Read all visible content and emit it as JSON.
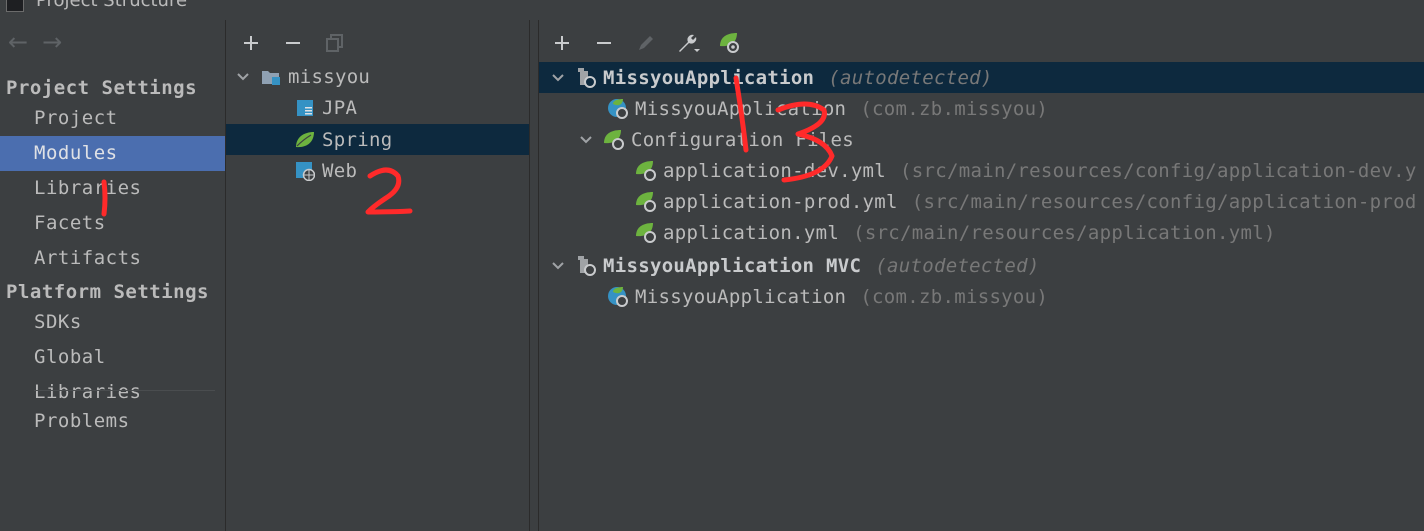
{
  "window": {
    "title": "Project Structure"
  },
  "left": {
    "project_settings_header": "Project Settings",
    "project_items": [
      "Project",
      "Modules",
      "Libraries",
      "Facets",
      "Artifacts"
    ],
    "selected_item": "Modules",
    "platform_settings_header": "Platform Settings",
    "platform_items": [
      "SDKs",
      "Global Libraries"
    ],
    "problems": "Problems"
  },
  "middle": {
    "module": "missyou",
    "facets": [
      "JPA",
      "Spring",
      "Web"
    ],
    "selected_facet": "Spring"
  },
  "right": {
    "contexts": [
      {
        "name": "MissyouApplication",
        "suffix": "(autodetected)",
        "app_class": "MissyouApplication",
        "app_package": "(com.zb.missyou)",
        "config_group": "Configuration Files",
        "files": [
          {
            "name": "application-dev.yml",
            "path": "(src/main/resources/config/application-dev.y"
          },
          {
            "name": "application-prod.yml",
            "path": "(src/main/resources/config/application-prod"
          },
          {
            "name": "application.yml",
            "path": "(src/main/resources/application.yml)"
          }
        ]
      },
      {
        "name": "MissyouApplication MVC",
        "suffix": "(autodetected)",
        "app_class": "MissyouApplication",
        "app_package": "(com.zb.missyou)"
      }
    ]
  },
  "annotations": [
    "1",
    "2",
    "3"
  ],
  "colors": {
    "background": "#3c3f41",
    "selection": "#4b6eaf",
    "tree_selection": "#0d293e",
    "spring_green": "#6db33f",
    "annotation_red": "#ff2a2a"
  }
}
